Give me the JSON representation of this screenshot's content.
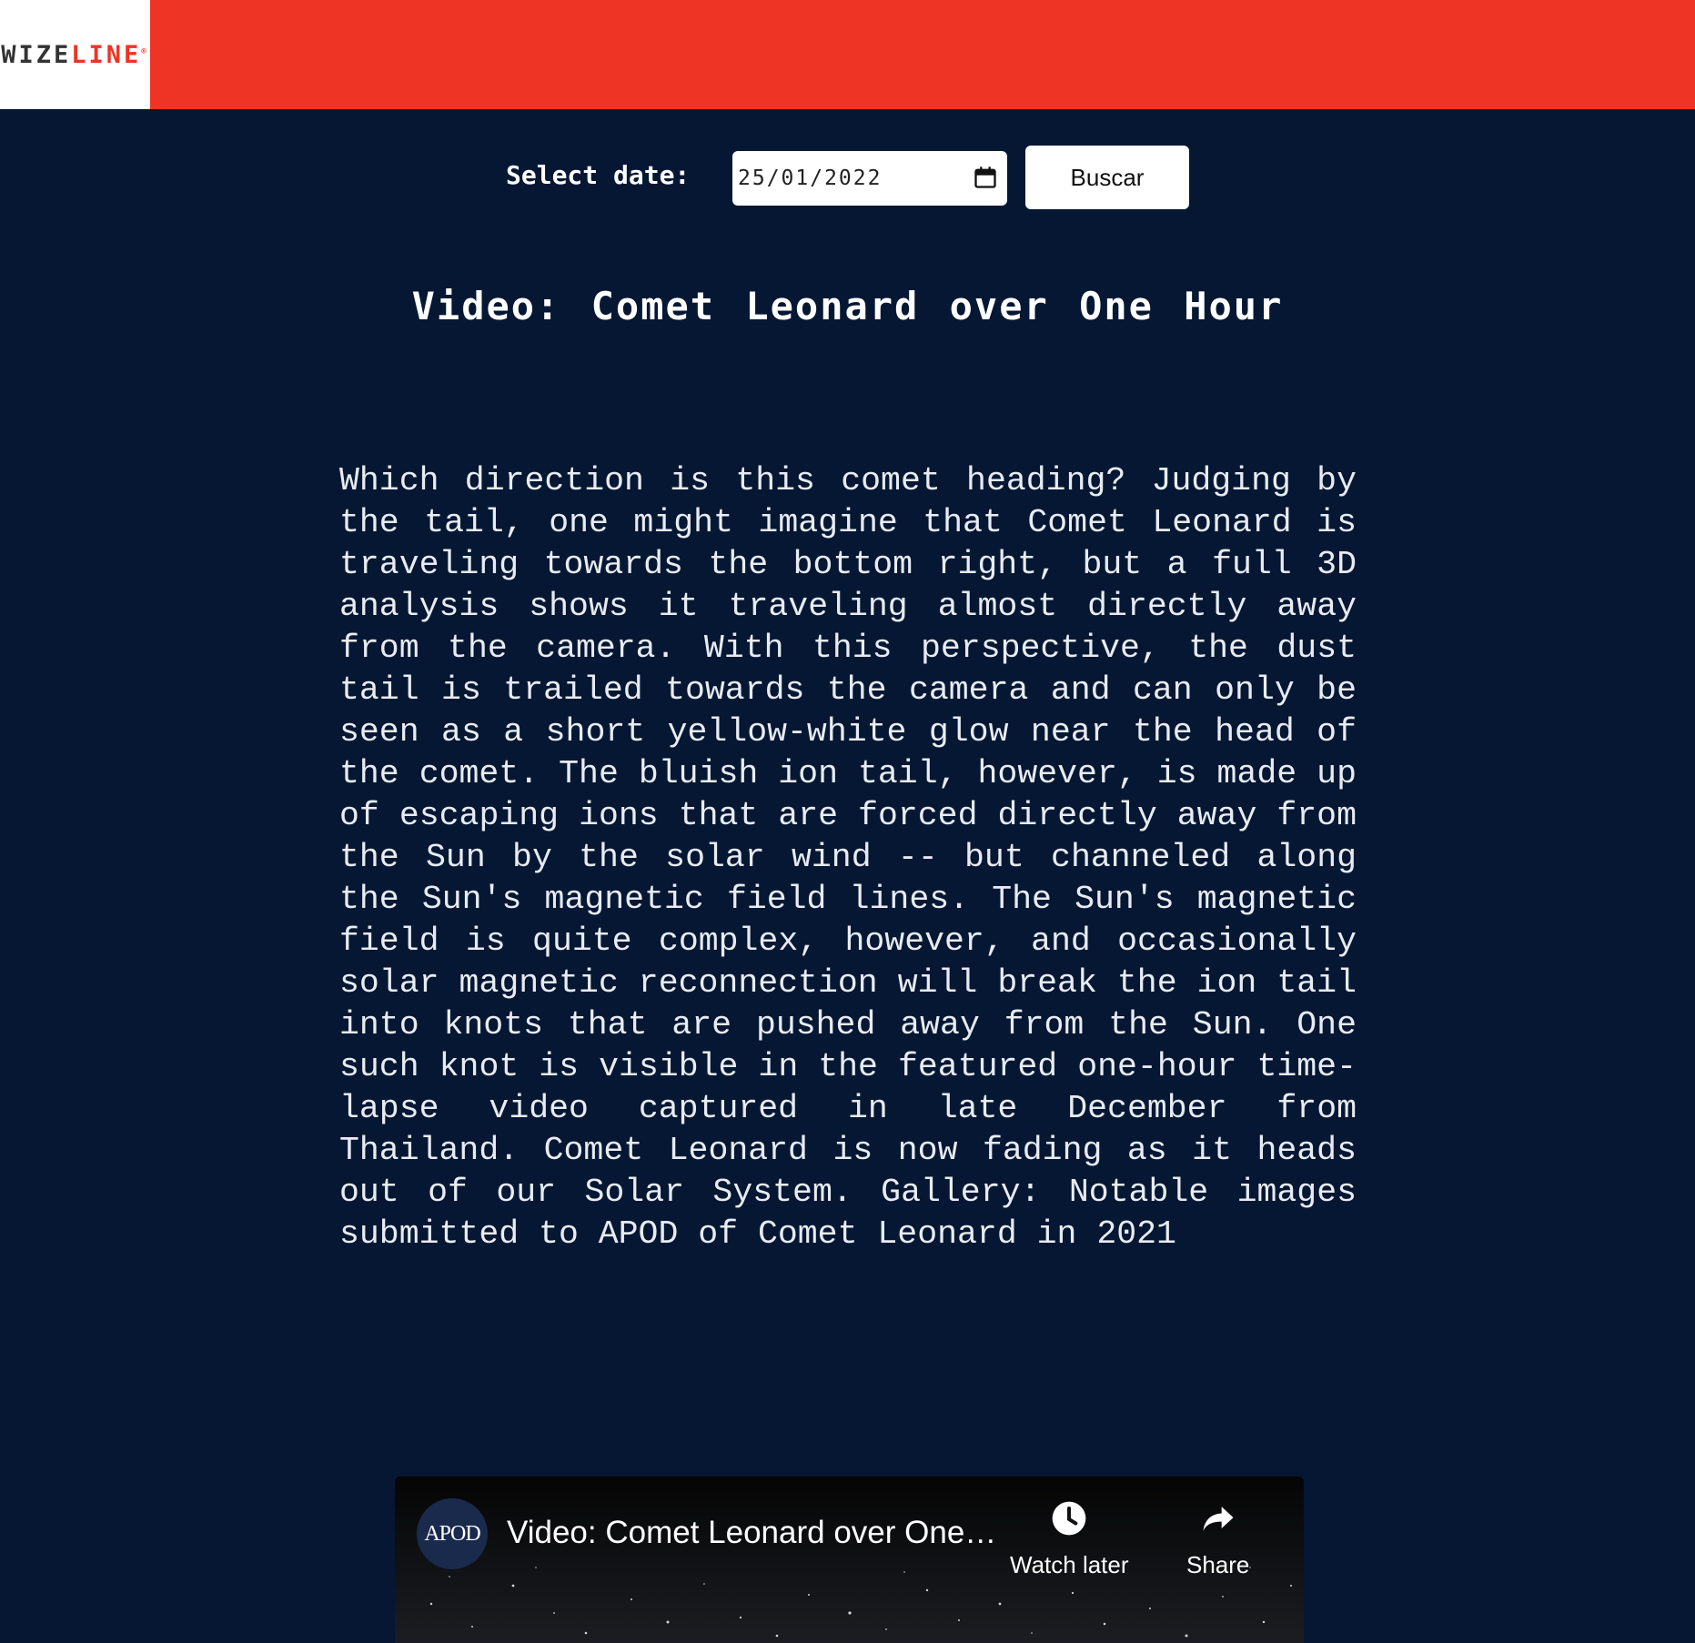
{
  "header": {
    "logo_main": "WIZE",
    "logo_accent": "LINE",
    "logo_mark": "®"
  },
  "date_picker": {
    "label": "Select date:",
    "value": "25/01/2022",
    "button_label": "Buscar"
  },
  "apod": {
    "title": "Video: Comet Leonard over One Hour",
    "explanation": "Which direction is this comet heading? Judging by the tail, one might imagine that Comet Leonard is traveling towards the bottom right, but a full 3D analysis shows it traveling almost directly away from the camera. With this perspective, the dust tail is trailed towards the camera and can only be seen as a short yellow-white glow near the head of the comet. The bluish ion tail, however, is made up of escaping ions that are forced directly away from the Sun by the solar wind -- but channeled along the Sun's magnetic field lines. The Sun's magnetic field is quite complex, however, and occasionally solar magnetic reconnection will break the ion tail into knots that are pushed away from the Sun. One such knot is visible in the featured one-hour time-lapse video captured in late December from Thailand. Comet Leonard is now fading as it heads out of our Solar System. Gallery: Notable images submitted to APOD of Comet Leonard in 2021"
  },
  "video": {
    "channel_logo_text": "APOD",
    "title": "Video: Comet Leonard over One…",
    "watch_later_label": "Watch later",
    "share_label": "Share"
  },
  "colors": {
    "header_red": "#ee3425",
    "background_navy": "#051733",
    "text_white": "#ffffff"
  }
}
